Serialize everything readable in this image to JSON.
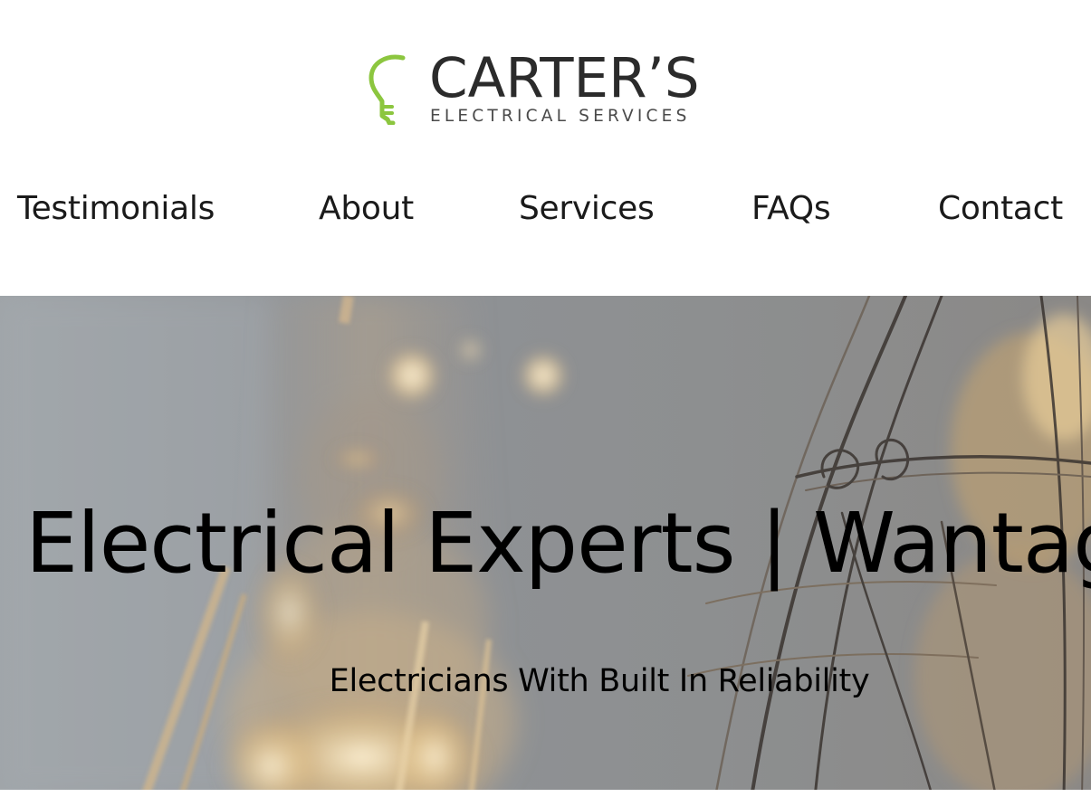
{
  "header": {
    "logo": {
      "name": "CARTER’S",
      "tagline": "ELECTRICAL SERVICES",
      "icon": "lightbulb-icon",
      "accent_color": "#8cc63f"
    }
  },
  "nav": {
    "items": [
      {
        "label": "Testimonials"
      },
      {
        "label": "About"
      },
      {
        "label": "Services"
      },
      {
        "label": "FAQs"
      },
      {
        "label": "Contact"
      }
    ]
  },
  "hero": {
    "title": "Electrical Experts | Wantage",
    "subtitle": "Electricians With Built In Reliability"
  }
}
